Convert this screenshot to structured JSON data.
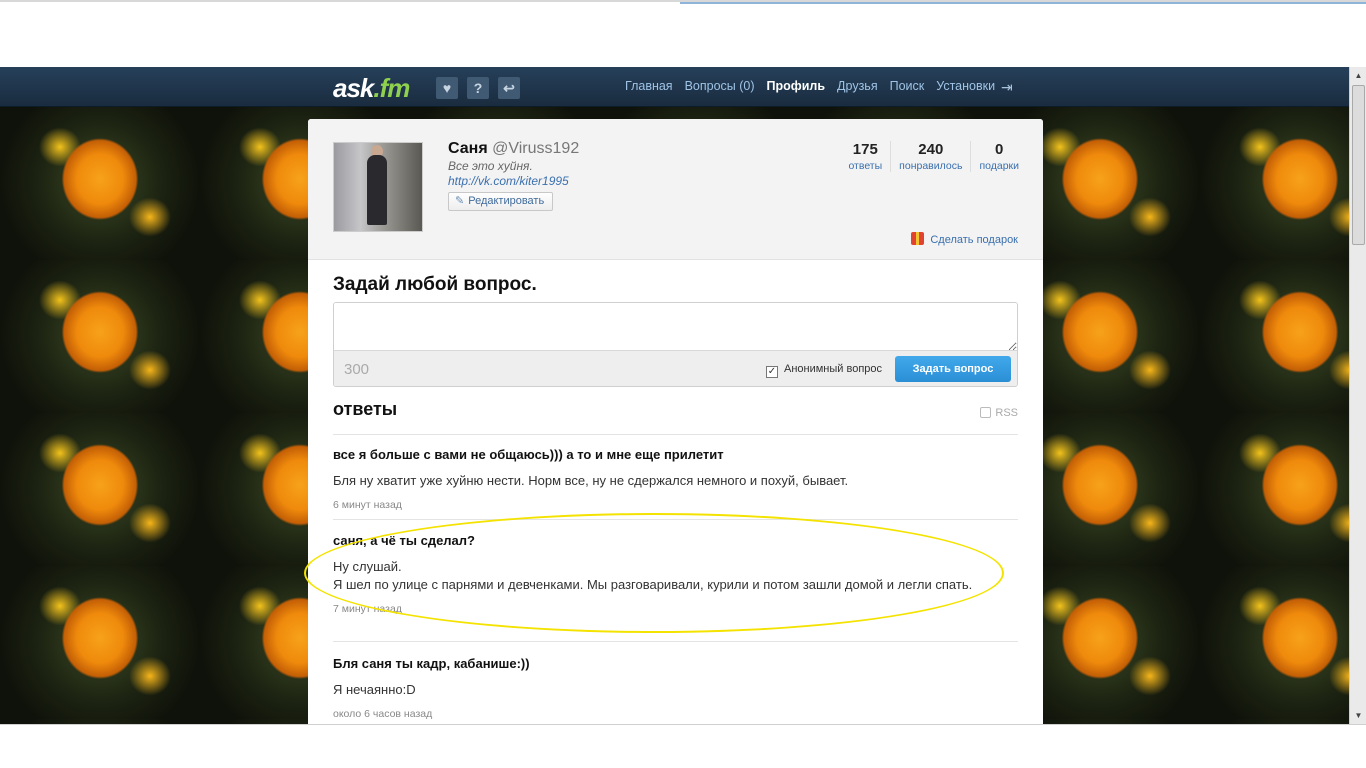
{
  "header": {
    "logo_main": "ask",
    "logo_dot": ".fm",
    "icons": [
      "heart-icon",
      "question-icon",
      "reply-icon"
    ],
    "nav": [
      {
        "label": "Главная",
        "active": false
      },
      {
        "label": "Вопросы (0)",
        "active": false
      },
      {
        "label": "Профиль",
        "active": true
      },
      {
        "label": "Друзья",
        "active": false
      },
      {
        "label": "Поиск",
        "active": false
      },
      {
        "label": "Установки",
        "active": false
      }
    ]
  },
  "profile": {
    "name": "Саня",
    "handle": "@Viruss192",
    "bio": "Все это хуйня.",
    "link": "http://vk.com/kiter1995",
    "edit_label": "Редактировать",
    "stats": [
      {
        "num": "175",
        "label": "ответы"
      },
      {
        "num": "240",
        "label": "понравилось"
      },
      {
        "num": "0",
        "label": "подарки"
      }
    ],
    "gift_label": "Сделать подарок"
  },
  "ask": {
    "title": "Задай любой вопрос.",
    "placeholder": "",
    "char_count": "300",
    "anon_label": "Анонимный вопрос",
    "anon_checked": true,
    "button": "Задать вопрос"
  },
  "answers": {
    "title": "ответы",
    "rss": "RSS",
    "items": [
      {
        "q": "все я больше с вами не общаюсь))) а то и мне еще прилетит",
        "a": "Бля ну хватит уже хуйню нести. Норм все, ну не сдержался немного и похуй, бывает.",
        "t": "6 минут назад"
      },
      {
        "q": "саня, а чё ты сделал?",
        "a1": "Ну слушай.",
        "a2": "Я шел по улице с парнями и девченками. Мы разговаривали, курили и потом зашли домой и легли спать.",
        "t": "7 минут назад"
      },
      {
        "q": "Бля саня ты кадр, кабанише:))",
        "a": "Я нечаянно:D",
        "t": "около 6 часов назад"
      }
    ]
  },
  "colors": {
    "header_bg": "#1f3449",
    "link": "#3a6fae",
    "ask_button": "#2b8fd6",
    "highlight": "#f4e300"
  }
}
